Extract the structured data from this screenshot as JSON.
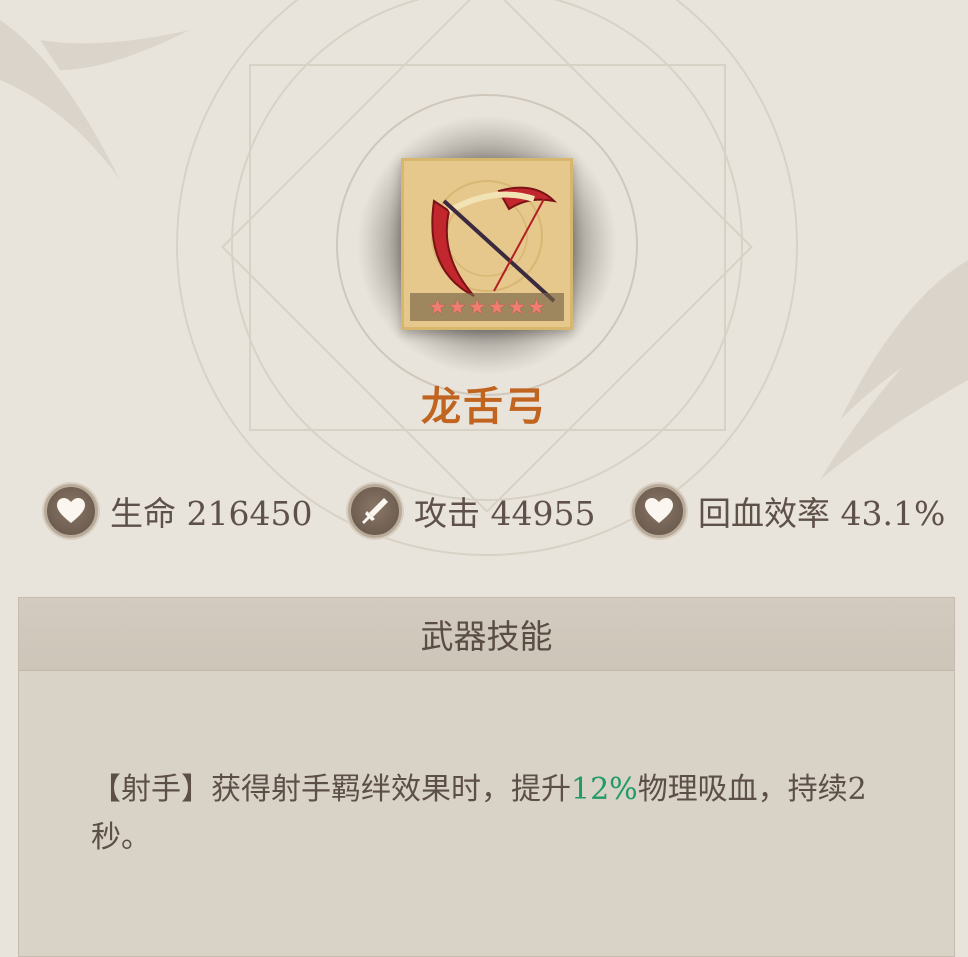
{
  "weapon": {
    "name": "龙舌弓",
    "star_count": 6,
    "stars": [
      "★",
      "★",
      "★",
      "★",
      "★",
      "★"
    ]
  },
  "stats": [
    {
      "icon": "heart-icon",
      "label": "生命",
      "value": "216450"
    },
    {
      "icon": "dagger-icon",
      "label": "攻击",
      "value": "44955"
    },
    {
      "icon": "heart-icon",
      "label": "回血效率",
      "value": "43.1%"
    }
  ],
  "skill_panel": {
    "title": "武器技能",
    "text_before": "【射手】获得射手羁绊效果时，提升",
    "highlight": "12%",
    "text_after": "物理吸血，持续2秒。"
  },
  "colors": {
    "name": "#c0641f",
    "highlight": "#1f9a68",
    "text": "#5e514a"
  }
}
